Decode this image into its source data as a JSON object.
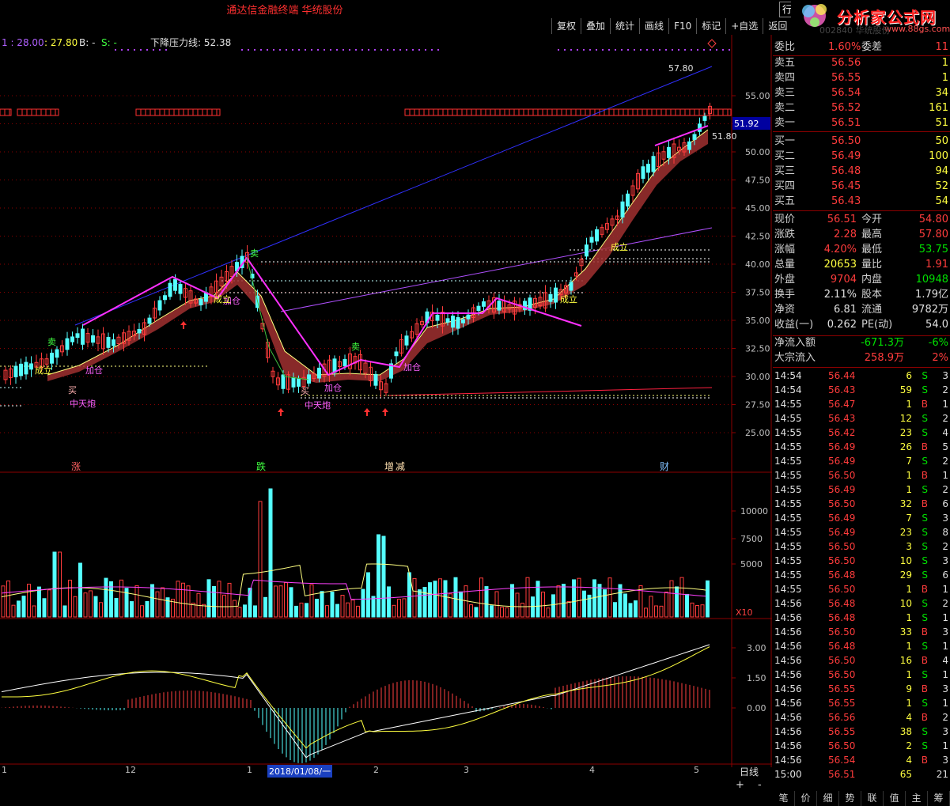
{
  "window": {
    "title": "通达信金融终端  华统股份",
    "corner_btn": "行",
    "close_icon": "close-icon"
  },
  "logo": {
    "text": "分析家公式网",
    "url_text": "www.88gs.com",
    "badge": "31",
    "faded": "002840 华统股份"
  },
  "toolbar": [
    "复权",
    "叠加",
    "统计",
    "画线",
    "F10",
    "标记",
    "+自选",
    "返回"
  ],
  "indicator_line": {
    "a": "1 : 28.00",
    "b": ": 27.80",
    "c": "B: -",
    "d": "S: -",
    "pressure": "下降压力线: 52.38"
  },
  "price_axis": [
    "55.00",
    "52.50",
    "50.00",
    "47.50",
    "45.00",
    "42.50",
    "40.00",
    "37.50",
    "35.00",
    "32.50",
    "30.00",
    "27.50",
    "25.00"
  ],
  "price_marker": "51.92",
  "annotations": {
    "high": "57.80",
    "low": "51.80",
    "zhang": "涨",
    "die": "跌",
    "zeng": "增",
    "jian": "减",
    "cai": "财",
    "buy1": "买",
    "buy2": "买",
    "sell1": "卖",
    "sell2": "卖",
    "sell3": "卖",
    "jiacang1": "加仓",
    "jiacang2": "加仓",
    "jiacang3": "加仓",
    "jiacang4": "加仓",
    "zhongtianpao1": "中天炮",
    "zhongtianpao2": "中天炮",
    "chengli1": "成立",
    "chengli2": "成立",
    "chengli3": "成立",
    "chengli4": "成立"
  },
  "volume_axis": [
    "10000",
    "7500",
    "5000"
  ],
  "volume_unit": "X10",
  "macd_axis": [
    "3.00",
    "1.50",
    "0.00"
  ],
  "x_axis": [
    "1",
    "12",
    "1",
    "2018/01/08/一",
    "2",
    "3",
    "4",
    "5"
  ],
  "period": "日线",
  "zoom": {
    "plus": "+",
    "minus": "-"
  },
  "quote": {
    "weibi": {
      "label": "委比",
      "value": "1.60%",
      "label2": "委差",
      "value2": "11"
    },
    "asks": [
      {
        "label": "卖五",
        "price": "56.56",
        "vol": "1"
      },
      {
        "label": "卖四",
        "price": "56.55",
        "vol": "1"
      },
      {
        "label": "卖三",
        "price": "56.54",
        "vol": "34"
      },
      {
        "label": "卖二",
        "price": "56.52",
        "vol": "161"
      },
      {
        "label": "卖一",
        "price": "56.51",
        "vol": "51"
      }
    ],
    "bids": [
      {
        "label": "买一",
        "price": "56.50",
        "vol": "50"
      },
      {
        "label": "买二",
        "price": "56.49",
        "vol": "100"
      },
      {
        "label": "买三",
        "price": "56.48",
        "vol": "94"
      },
      {
        "label": "买四",
        "price": "56.45",
        "vol": "52"
      },
      {
        "label": "买五",
        "price": "56.43",
        "vol": "54"
      }
    ],
    "stats": [
      {
        "l1": "现价",
        "v1": "56.51",
        "c1": "red",
        "l2": "今开",
        "v2": "54.80",
        "c2": "red"
      },
      {
        "l1": "涨跌",
        "v1": "2.28",
        "c1": "red",
        "l2": "最高",
        "v2": "57.80",
        "c2": "red"
      },
      {
        "l1": "涨幅",
        "v1": "4.20%",
        "c1": "red",
        "l2": "最低",
        "v2": "53.75",
        "c2": "green"
      },
      {
        "l1": "总量",
        "v1": "20653",
        "c1": "yellow",
        "l2": "量比",
        "v2": "1.91",
        "c2": "red"
      },
      {
        "l1": "外盘",
        "v1": "9704",
        "c1": "red",
        "l2": "内盘",
        "v2": "10948",
        "c2": "green"
      },
      {
        "l1": "换手",
        "v1": "2.11%",
        "c1": "white",
        "l2": "股本",
        "v2": "1.79亿",
        "c2": "white"
      },
      {
        "l1": "净资",
        "v1": "6.81",
        "c1": "white",
        "l2": "流通",
        "v2": "9782万",
        "c2": "white"
      },
      {
        "l1": "收益(一)",
        "v1": "0.262",
        "c1": "white",
        "l2": "PE(动)",
        "v2": "54.0",
        "c2": "white"
      }
    ],
    "flows": [
      {
        "label": "净流入额",
        "value": "-671.3万",
        "pct": "-6%",
        "color": "green"
      },
      {
        "label": "大宗流入",
        "value": "258.9万",
        "pct": "2%",
        "color": "red"
      }
    ]
  },
  "ticks": [
    {
      "t": "14:54",
      "p": "56.44",
      "v": "6",
      "s": "S",
      "n": "3"
    },
    {
      "t": "14:54",
      "p": "56.43",
      "v": "59",
      "s": "S",
      "n": "2"
    },
    {
      "t": "14:55",
      "p": "56.47",
      "v": "1",
      "s": "B",
      "n": "1"
    },
    {
      "t": "14:55",
      "p": "56.43",
      "v": "12",
      "s": "S",
      "n": "2"
    },
    {
      "t": "14:55",
      "p": "56.42",
      "v": "23",
      "s": "S",
      "n": "4"
    },
    {
      "t": "14:55",
      "p": "56.49",
      "v": "26",
      "s": "B",
      "n": "5"
    },
    {
      "t": "14:55",
      "p": "56.49",
      "v": "7",
      "s": "S",
      "n": "2"
    },
    {
      "t": "14:55",
      "p": "56.50",
      "v": "1",
      "s": "B",
      "n": "1"
    },
    {
      "t": "14:55",
      "p": "56.49",
      "v": "1",
      "s": "S",
      "n": "2"
    },
    {
      "t": "14:55",
      "p": "56.50",
      "v": "32",
      "s": "B",
      "n": "6"
    },
    {
      "t": "14:55",
      "p": "56.49",
      "v": "7",
      "s": "S",
      "n": "3"
    },
    {
      "t": "14:55",
      "p": "56.49",
      "v": "23",
      "s": "S",
      "n": "8"
    },
    {
      "t": "14:55",
      "p": "56.50",
      "v": "3",
      "s": "S",
      "n": "2"
    },
    {
      "t": "14:55",
      "p": "56.50",
      "v": "10",
      "s": "S",
      "n": "3"
    },
    {
      "t": "14:55",
      "p": "56.48",
      "v": "29",
      "s": "S",
      "n": "6"
    },
    {
      "t": "14:55",
      "p": "56.50",
      "v": "1",
      "s": "B",
      "n": "1"
    },
    {
      "t": "14:56",
      "p": "56.48",
      "v": "10",
      "s": "S",
      "n": "2"
    },
    {
      "t": "14:56",
      "p": "56.48",
      "v": "1",
      "s": "S",
      "n": "1"
    },
    {
      "t": "14:56",
      "p": "56.50",
      "v": "33",
      "s": "B",
      "n": "3"
    },
    {
      "t": "14:56",
      "p": "56.48",
      "v": "1",
      "s": "S",
      "n": "1"
    },
    {
      "t": "14:56",
      "p": "56.50",
      "v": "16",
      "s": "B",
      "n": "4"
    },
    {
      "t": "14:56",
      "p": "56.50",
      "v": "1",
      "s": "S",
      "n": "1"
    },
    {
      "t": "14:56",
      "p": "56.55",
      "v": "9",
      "s": "B",
      "n": "3"
    },
    {
      "t": "14:56",
      "p": "56.55",
      "v": "1",
      "s": "S",
      "n": "1"
    },
    {
      "t": "14:56",
      "p": "56.56",
      "v": "4",
      "s": "B",
      "n": "2"
    },
    {
      "t": "14:56",
      "p": "56.55",
      "v": "38",
      "s": "S",
      "n": "3"
    },
    {
      "t": "14:56",
      "p": "56.50",
      "v": "2",
      "s": "S",
      "n": "1"
    },
    {
      "t": "14:56",
      "p": "56.54",
      "v": "4",
      "s": "B",
      "n": "3"
    },
    {
      "t": "15:00",
      "p": "56.51",
      "v": "65",
      "s": "",
      "n": "21"
    }
  ],
  "bottom_tabs": [
    "笔",
    "价",
    "细",
    "势",
    "联",
    "值",
    "主",
    "筹"
  ],
  "colors": {
    "up": "#ff3c3c",
    "down": "#54ffff",
    "ma": "#ff00ff",
    "bg": "#000000"
  }
}
